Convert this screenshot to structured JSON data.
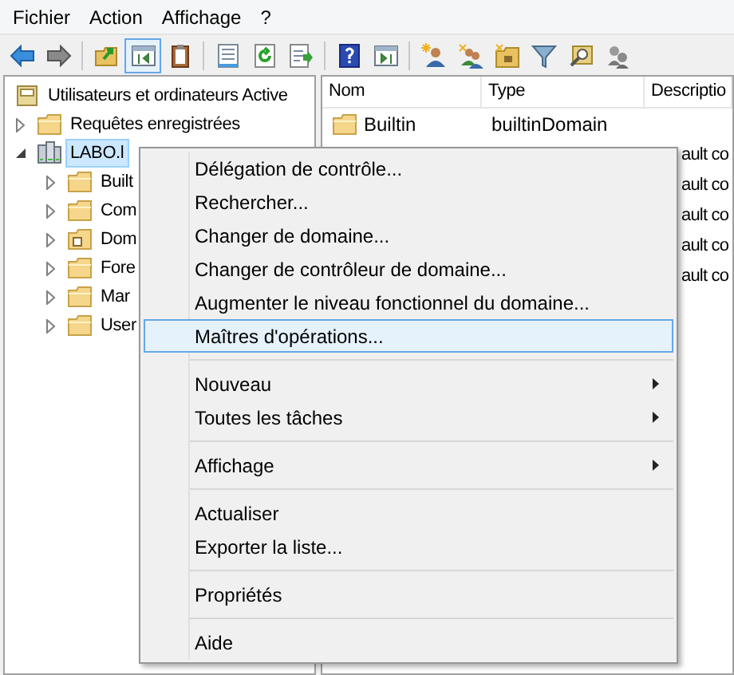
{
  "menubar": [
    {
      "label": "Fichier"
    },
    {
      "label": "Action"
    },
    {
      "label": "Affichage"
    },
    {
      "label": "?"
    }
  ],
  "toolbar": [
    [
      {
        "pressed": false
      },
      {
        "pressed": false
      }
    ],
    [
      {
        "pressed": false
      },
      {
        "pressed": true
      },
      {
        "pressed": false
      }
    ],
    [
      {
        "pressed": false
      },
      {
        "pressed": false
      },
      {
        "pressed": false
      }
    ],
    [
      {
        "pressed": false
      },
      {
        "pressed": false
      }
    ],
    [
      {
        "pressed": false
      },
      {
        "pressed": false
      },
      {
        "pressed": false
      },
      {
        "pressed": false
      },
      {
        "pressed": false
      },
      {
        "pressed": false
      }
    ]
  ],
  "tree": [
    {
      "label": "Utilisateurs et ordinateurs Active",
      "kind": "console",
      "selected": false,
      "children": [
        {
          "label": "Requêtes enregistrées",
          "kind": "folder",
          "selected": false,
          "expanded": false
        },
        {
          "label": "LABO.l",
          "kind": "domain",
          "selected": true,
          "expanded": true,
          "children": [
            {
              "label": "Built",
              "kind": "folder",
              "selected": false,
              "expanded": false
            },
            {
              "label": "Com",
              "kind": "folder",
              "selected": false,
              "expanded": false
            },
            {
              "label": "Dom",
              "kind": "ou",
              "selected": false,
              "expanded": false
            },
            {
              "label": "Fore",
              "kind": "folder",
              "selected": false,
              "expanded": false
            },
            {
              "label": "Mar",
              "kind": "folder",
              "selected": false,
              "expanded": false
            },
            {
              "label": "User",
              "kind": "folder",
              "selected": false,
              "expanded": false
            }
          ]
        }
      ]
    }
  ],
  "table": {
    "columns": [
      "Nom",
      "Type",
      "Descriptio"
    ],
    "rows": [
      {
        "nom": "Builtin",
        "type": "builtinDomain"
      },
      {
        "column_3": "ault co"
      },
      {
        "column_3": "ault co"
      },
      {
        "column_3": "ault co"
      },
      {
        "column_3": "ault co"
      },
      {
        "column_3": "ault co"
      }
    ]
  },
  "context_menu": [
    {
      "kind": "item",
      "label": "Délégation de contrôle...",
      "selected": false
    },
    {
      "kind": "item",
      "label": "Rechercher...",
      "selected": false
    },
    {
      "kind": "item",
      "label": "Changer de domaine...",
      "selected": false
    },
    {
      "kind": "item",
      "label": "Changer de contrôleur de domaine...",
      "selected": false
    },
    {
      "kind": "item",
      "label": "Augmenter le niveau fonctionnel du domaine...",
      "selected": false
    },
    {
      "kind": "item",
      "label": "Maîtres d'opérations...",
      "selected": true
    },
    {
      "kind": "separator"
    },
    {
      "kind": "submenu",
      "label": "Nouveau",
      "selected": false
    },
    {
      "kind": "submenu",
      "label": "Toutes les tâches",
      "selected": false
    },
    {
      "kind": "separator"
    },
    {
      "kind": "submenu",
      "label": "Affichage",
      "selected": false
    },
    {
      "kind": "separator"
    },
    {
      "kind": "item",
      "label": "Actualiser",
      "selected": false
    },
    {
      "kind": "item",
      "label": "Exporter la liste...",
      "selected": false
    },
    {
      "kind": "separator"
    },
    {
      "kind": "item",
      "label": "Propriétés",
      "selected": false
    },
    {
      "kind": "separator"
    },
    {
      "kind": "item",
      "label": "Aide",
      "selected": false
    }
  ]
}
